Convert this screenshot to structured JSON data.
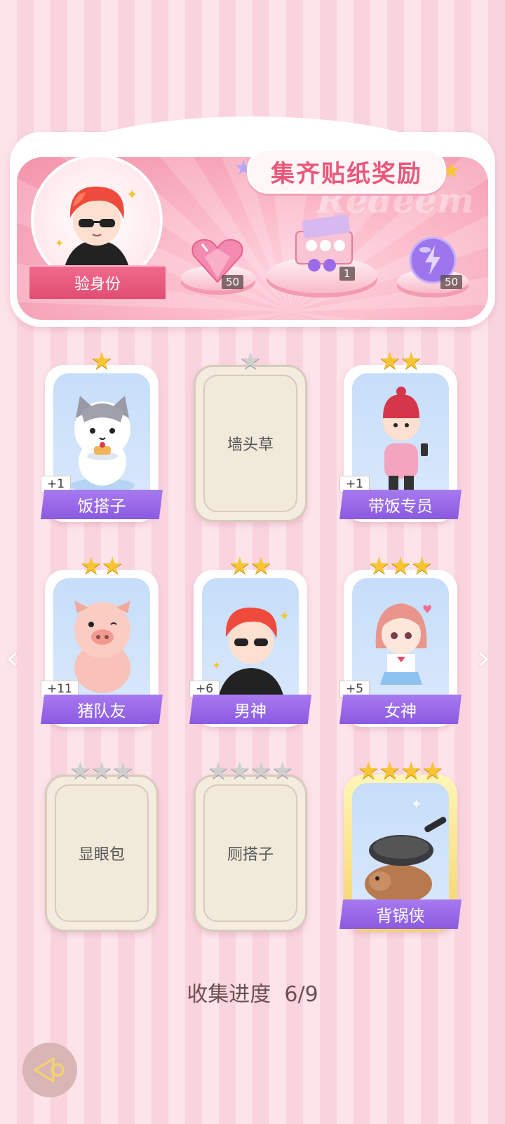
{
  "banner": {
    "title": "集齐贴纸奖励",
    "watermark": "Redeem",
    "verify_label": "验身份",
    "rewards": [
      {
        "name": "pink-heart-gem",
        "count": "50"
      },
      {
        "name": "gift-box",
        "count": "1"
      },
      {
        "name": "purple-energy-orb",
        "count": "50"
      }
    ]
  },
  "stickers": [
    {
      "name": "饭搭子",
      "stars": 1,
      "plus": "+1",
      "owned": true,
      "icon": "cat-with-pancake"
    },
    {
      "name": "墙头草",
      "stars": 1,
      "plus": "",
      "owned": false
    },
    {
      "name": "带饭专员",
      "stars": 2,
      "plus": "+1",
      "owned": true,
      "icon": "girl-with-beanie"
    },
    {
      "name": "猪队友",
      "stars": 2,
      "plus": "+11",
      "owned": true,
      "icon": "pig"
    },
    {
      "name": "男神",
      "stars": 2,
      "plus": "+6",
      "owned": true,
      "icon": "boy-with-sunglasses"
    },
    {
      "name": "女神",
      "stars": 3,
      "plus": "+5",
      "owned": true,
      "icon": "girl-in-uniform"
    },
    {
      "name": "显眼包",
      "stars": 3,
      "plus": "",
      "owned": false
    },
    {
      "name": "厕搭子",
      "stars": 4,
      "plus": "",
      "owned": false
    },
    {
      "name": "背锅侠",
      "stars": 4,
      "plus": "",
      "owned": true,
      "icon": "capybara-with-pan"
    }
  ],
  "progress": {
    "label": "收集进度",
    "value": "6/9"
  },
  "nav": {
    "left": "‹",
    "right": "›"
  },
  "colors": {
    "accent": "#e8587a",
    "name_bar": "#9466e8",
    "star_gold": "#f7c531"
  }
}
